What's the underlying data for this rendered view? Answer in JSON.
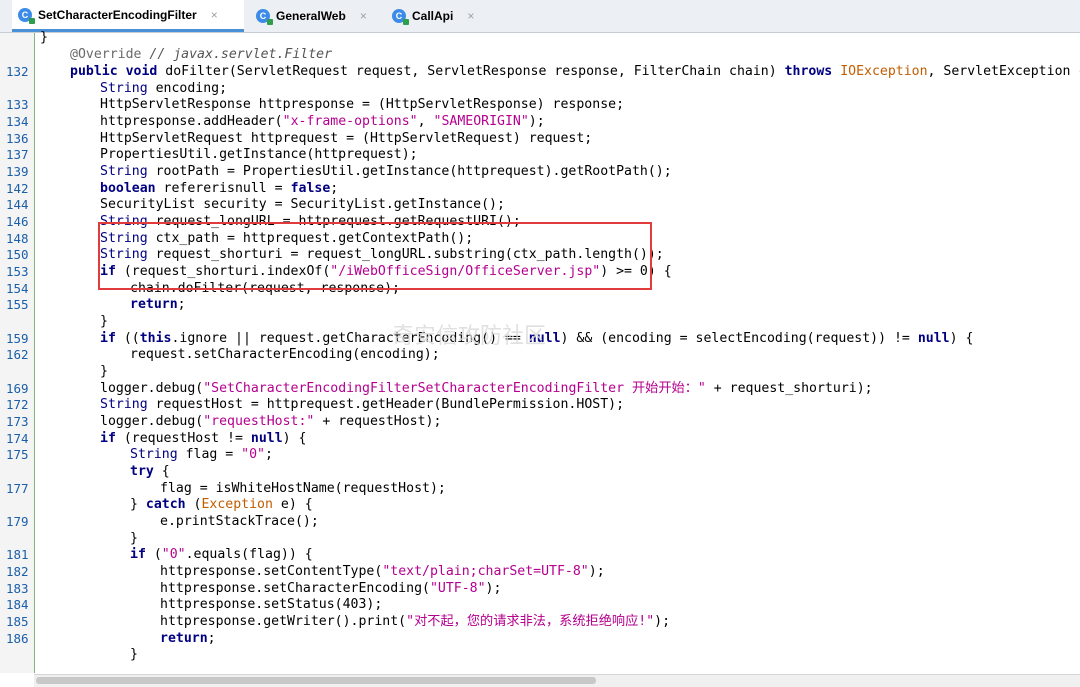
{
  "tabs": [
    {
      "label": "SetCharacterEncodingFilter",
      "active": true
    },
    {
      "label": "GeneralWeb",
      "active": false
    },
    {
      "label": "CallApi",
      "active": false
    }
  ],
  "tab_close_glyph": "×",
  "watermark": "奇安信攻防社区",
  "lines": [
    {
      "ln": "",
      "text": "}"
    },
    {
      "ln": "",
      "text": "@Override // javax.servlet.Filter"
    },
    {
      "ln": "132",
      "text": "public void doFilter(ServletRequest request, ServletResponse response, FilterChain chain) throws IOException, ServletException {"
    },
    {
      "ln": "",
      "text": "String encoding;"
    },
    {
      "ln": "133",
      "text": "HttpServletResponse httpresponse = (HttpServletResponse) response;"
    },
    {
      "ln": "134",
      "text": "httpresponse.addHeader(\"x-frame-options\", \"SAMEORIGIN\");"
    },
    {
      "ln": "136",
      "text": "HttpServletRequest httprequest = (HttpServletRequest) request;"
    },
    {
      "ln": "137",
      "text": "PropertiesUtil.getInstance(httprequest);"
    },
    {
      "ln": "139",
      "text": "String rootPath = PropertiesUtil.getInstance(httprequest).getRootPath();"
    },
    {
      "ln": "142",
      "text": "boolean refererisnull = false;"
    },
    {
      "ln": "144",
      "text": "SecurityList security = SecurityList.getInstance();"
    },
    {
      "ln": "146",
      "text": "String request_longURL = httprequest.getRequestURI();"
    },
    {
      "ln": "148",
      "text": "String ctx_path = httprequest.getContextPath();"
    },
    {
      "ln": "150",
      "text": "String request_shorturi = request_longURL.substring(ctx_path.length());"
    },
    {
      "ln": "153",
      "text": "if (request_shorturi.indexOf(\"/iWebOfficeSign/OfficeServer.jsp\") >= 0) {"
    },
    {
      "ln": "154",
      "text": "chain.doFilter(request, response);"
    },
    {
      "ln": "155",
      "text": "return;"
    },
    {
      "ln": "",
      "text": "}"
    },
    {
      "ln": "159",
      "text": "if ((this.ignore || request.getCharacterEncoding() == null) && (encoding = selectEncoding(request)) != null) {"
    },
    {
      "ln": "162",
      "text": "request.setCharacterEncoding(encoding);"
    },
    {
      "ln": "",
      "text": "}"
    },
    {
      "ln": "169",
      "text": "logger.debug(\"SetCharacterEncodingFilterSetCharacterEncodingFilter 开始开始：\" + request_shorturi);"
    },
    {
      "ln": "172",
      "text": "String requestHost = httprequest.getHeader(BundlePermission.HOST);"
    },
    {
      "ln": "173",
      "text": "logger.debug(\"requestHost:\" + requestHost);"
    },
    {
      "ln": "174",
      "text": "if (requestHost != null) {"
    },
    {
      "ln": "175",
      "text": "String flag = \"0\";"
    },
    {
      "ln": "",
      "text": "try {"
    },
    {
      "ln": "177",
      "text": "flag = isWhiteHostName(requestHost);"
    },
    {
      "ln": "",
      "text": "} catch (Exception e) {"
    },
    {
      "ln": "179",
      "text": "e.printStackTrace();"
    },
    {
      "ln": "",
      "text": "}"
    },
    {
      "ln": "181",
      "text": "if (\"0\".equals(flag)) {"
    },
    {
      "ln": "182",
      "text": "httpresponse.setContentType(\"text/plain;charSet=UTF-8\");"
    },
    {
      "ln": "183",
      "text": "httpresponse.setCharacterEncoding(\"UTF-8\");"
    },
    {
      "ln": "184",
      "text": "httpresponse.setStatus(403);"
    },
    {
      "ln": "185",
      "text": "httpresponse.getWriter().print(\"对不起，您的请求非法，系统拒绝响应!\");"
    },
    {
      "ln": "186",
      "text": "return;"
    },
    {
      "ln": "",
      "text": "}"
    }
  ]
}
